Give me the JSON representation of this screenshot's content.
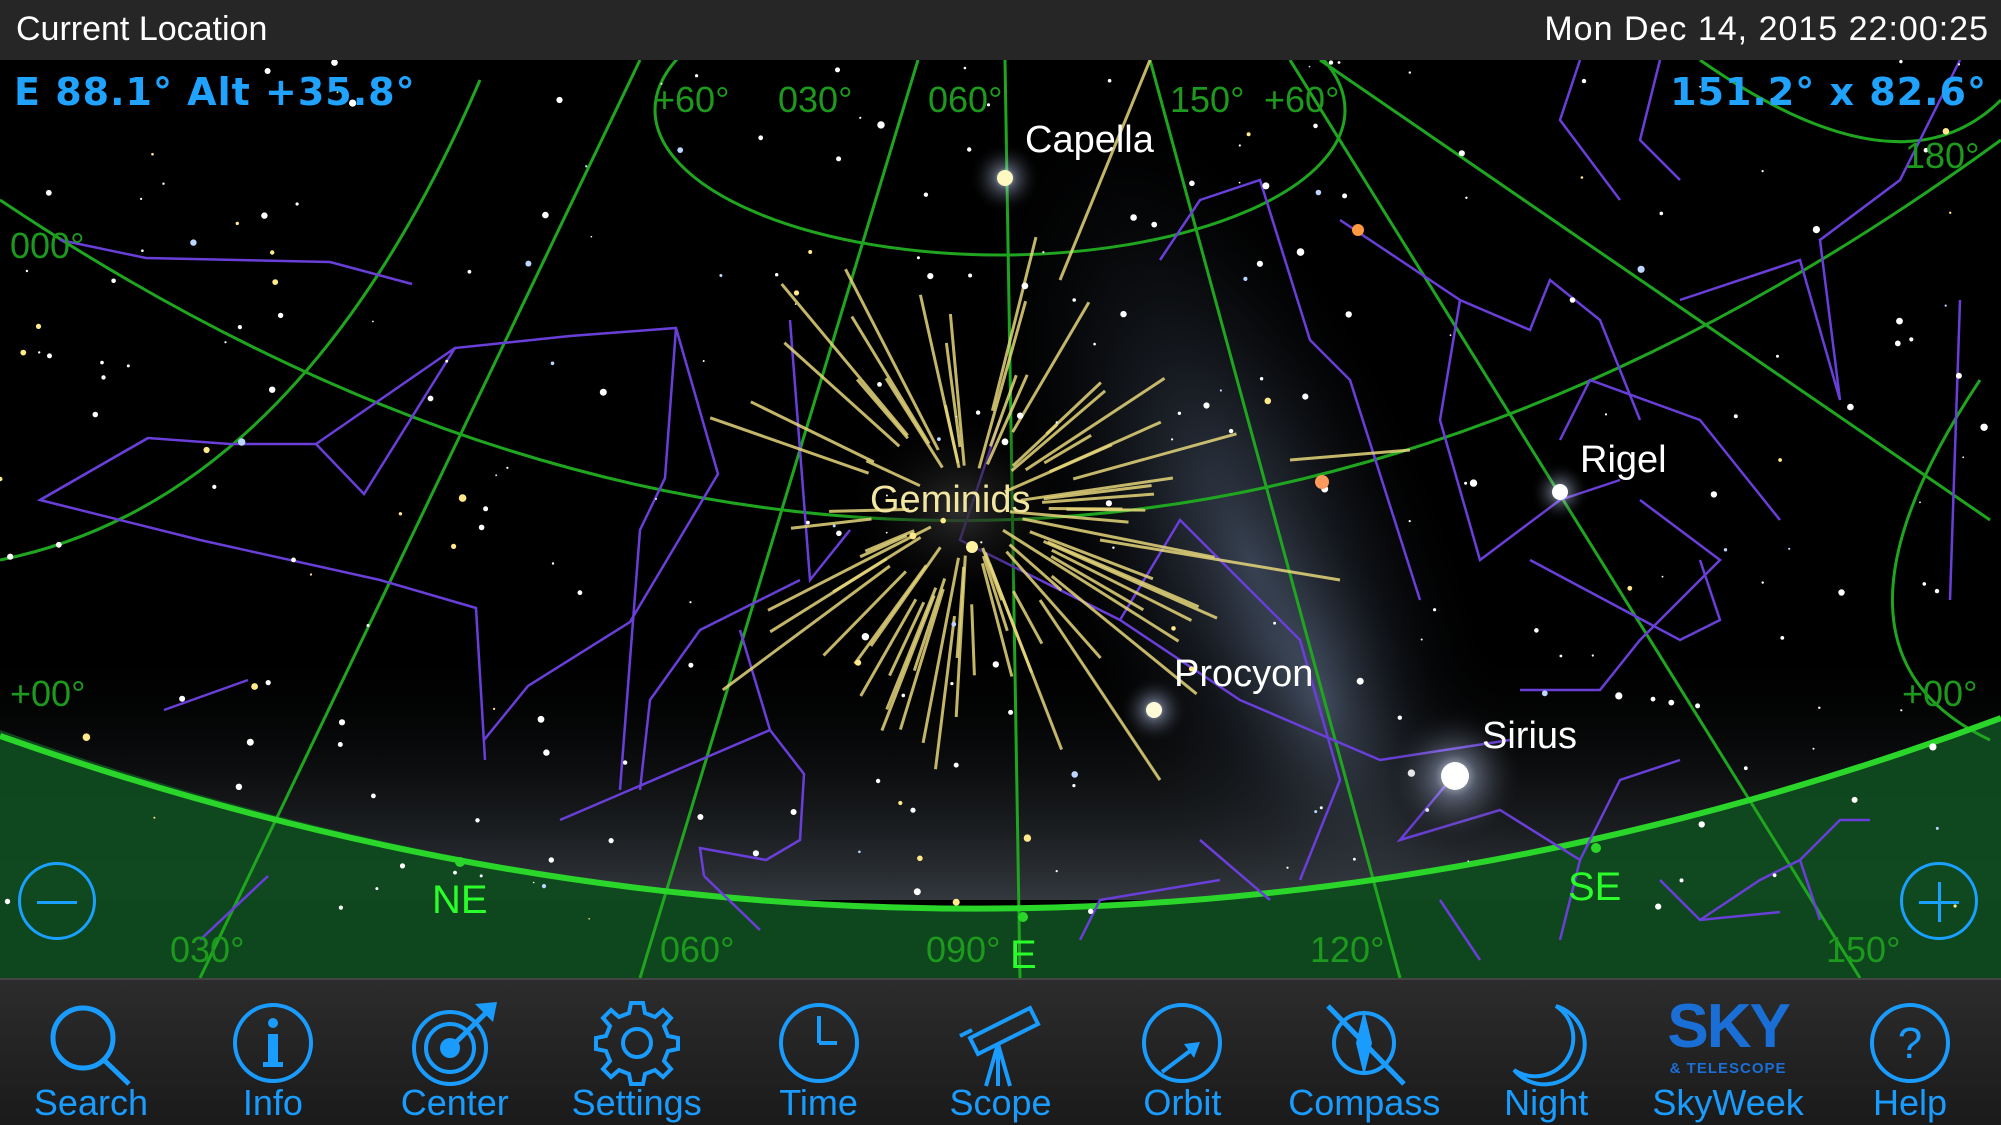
{
  "status_bar": {
    "location": "Current Location",
    "datetime": "Mon Dec 14, 2015  22:00:25"
  },
  "hud": {
    "pointing": "E 88.1° Alt +35.8°",
    "field_of_view": "151.2° x 82.6°"
  },
  "sky": {
    "star_labels": [
      "Capella",
      "Rigel",
      "Procyon",
      "Sirius"
    ],
    "meteor_shower": "Geminids",
    "compass_labels": [
      "NE",
      "E",
      "SE"
    ],
    "grid_labels": {
      "top": [
        "+60°",
        "030°",
        "060°",
        "150°",
        "+60°",
        "180°"
      ],
      "left": [
        "000°",
        "+00°"
      ],
      "right": [
        "+00°"
      ],
      "horizon": [
        "030°",
        "060°",
        "090°",
        "120°",
        "150°"
      ]
    },
    "colors": {
      "grid": "#1fa51f",
      "horizon": "#2bd62b",
      "ground": "#0f4a1f",
      "constellation": "#6a3fd9",
      "meteor": "#e5d67a",
      "hud": "#1fa3ff"
    }
  },
  "zoom": {
    "out_icon": "minus-icon",
    "in_icon": "plus-icon"
  },
  "toolbar": [
    {
      "id": "search",
      "label": "Search",
      "icon": "magnifier-icon"
    },
    {
      "id": "info",
      "label": "Info",
      "icon": "info-icon"
    },
    {
      "id": "center",
      "label": "Center",
      "icon": "target-icon"
    },
    {
      "id": "settings",
      "label": "Settings",
      "icon": "gear-icon"
    },
    {
      "id": "time",
      "label": "Time",
      "icon": "clock-icon"
    },
    {
      "id": "scope",
      "label": "Scope",
      "icon": "telescope-icon"
    },
    {
      "id": "orbit",
      "label": "Orbit",
      "icon": "orbit-icon"
    },
    {
      "id": "compass",
      "label": "Compass",
      "icon": "compass-icon"
    },
    {
      "id": "night",
      "label": "Night",
      "icon": "moon-icon"
    },
    {
      "id": "skyweek",
      "label": "SkyWeek",
      "icon": "sky-telescope-logo",
      "logo_text": "SKY",
      "logo_subtext": "& TELESCOPE"
    },
    {
      "id": "help",
      "label": "Help",
      "icon": "help-icon"
    }
  ]
}
